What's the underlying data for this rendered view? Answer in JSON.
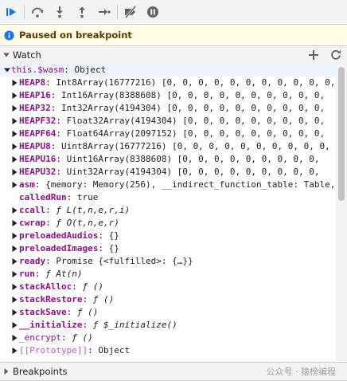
{
  "toolbar": {
    "buttons": [
      {
        "name": "resume-icon",
        "title": "Resume script execution"
      },
      {
        "name": "step-over-icon",
        "title": "Step over next function call"
      },
      {
        "name": "step-into-icon",
        "title": "Step into next function call"
      },
      {
        "name": "step-out-icon",
        "title": "Step out of current function"
      },
      {
        "name": "step-icon",
        "title": "Step"
      },
      {
        "name": "deactivate-breakpoints-icon",
        "title": "Deactivate breakpoints"
      },
      {
        "name": "pause-on-exceptions-icon",
        "title": "Pause on exceptions"
      }
    ],
    "accent_color": "#1a73e8"
  },
  "paused_banner": {
    "text": "Paused on breakpoint"
  },
  "watch": {
    "title": "Watch",
    "add_icon": "plus-icon",
    "refresh_icon": "refresh-icon",
    "root": {
      "key": "this.$wasm",
      "value": "Object"
    },
    "items": [
      {
        "key": "HEAP8",
        "value": "Int8Array(16777216) [0, 0, 0, 0, 0, 0, 0, 0, 0, 0, 0,",
        "arrow": true,
        "style": "bold"
      },
      {
        "key": "HEAP16",
        "value": "Int16Array(8388608) [0, 0, 0, 0, 0, 0, 0, 0, 0, 0,",
        "arrow": true,
        "style": "bold"
      },
      {
        "key": "HEAP32",
        "value": "Int32Array(4194304) [0, 0, 0, 0, 0, 0, 0, 0, 0, 0,",
        "arrow": true,
        "style": "bold"
      },
      {
        "key": "HEAPF32",
        "value": "Float32Array(4194304) [0, 0, 0, 0, 0, 0, 0, 0, 0,",
        "arrow": true,
        "style": "bold"
      },
      {
        "key": "HEAPF64",
        "value": "Float64Array(2097152) [0, 0, 0, 0, 0, 0, 0, 0, 0,",
        "arrow": true,
        "style": "bold"
      },
      {
        "key": "HEAPU8",
        "value": "Uint8Array(16777216) [0, 0, 0, 0, 0, 0, 0, 0, 0, 0,",
        "arrow": true,
        "style": "bold"
      },
      {
        "key": "HEAPU16",
        "value": "Uint16Array(8388608) [0, 0, 0, 0, 0, 0, 0, 0, 0,",
        "arrow": true,
        "style": "bold"
      },
      {
        "key": "HEAPU32",
        "value": "Uint32Array(4194304) [0, 0, 0, 0, 0, 0, 0, 0, 0,",
        "arrow": true,
        "style": "bold"
      },
      {
        "key": "asm",
        "value": "{memory: Memory(256), __indirect_function_table: Table,",
        "arrow": true,
        "style": "bold"
      },
      {
        "key": "calledRun",
        "value": "true",
        "arrow": false,
        "style": "bold"
      },
      {
        "key": "ccall",
        "fn": "ƒ",
        "sig": "L(t,n,e,r,i)",
        "arrow": true,
        "style": "bold"
      },
      {
        "key": "cwrap",
        "fn": "ƒ",
        "sig": "O(t,n,e,r)",
        "arrow": true,
        "style": "bold"
      },
      {
        "key": "preloadedAudios",
        "value": "{}",
        "arrow": true,
        "style": "bold"
      },
      {
        "key": "preloadedImages",
        "value": "{}",
        "arrow": true,
        "style": "bold"
      },
      {
        "key": "ready",
        "value": "Promise {<fulfilled>: {…}}",
        "arrow": true,
        "style": "bold"
      },
      {
        "key": "run",
        "fn": "ƒ",
        "sig": "At(n)",
        "arrow": true,
        "style": "bold"
      },
      {
        "key": "stackAlloc",
        "fn": "ƒ",
        "sig": "()",
        "arrow": true,
        "style": "bold"
      },
      {
        "key": "stackRestore",
        "fn": "ƒ",
        "sig": "()",
        "arrow": true,
        "style": "bold"
      },
      {
        "key": "stackSave",
        "fn": "ƒ",
        "sig": "()",
        "arrow": true,
        "style": "bold"
      },
      {
        "key": "__initialize",
        "fn": "ƒ",
        "sig": "$_initialize()",
        "arrow": true,
        "style": "bold"
      },
      {
        "key": "_encrypt",
        "fn": "ƒ",
        "sig": "()",
        "arrow": true,
        "style": "normal"
      },
      {
        "key": "[[Prototype]]",
        "value": "Object",
        "arrow": true,
        "style": "proto"
      }
    ]
  },
  "breakpoints": {
    "title": "Breakpoints"
  },
  "watermark": {
    "text": "公众号 · 猿榜编程"
  }
}
